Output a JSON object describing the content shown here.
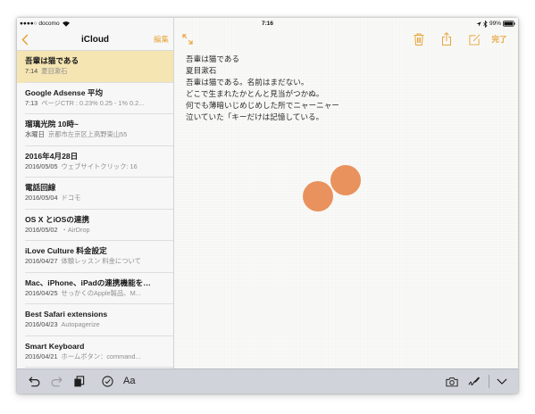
{
  "status_bar": {
    "carrier": "●●●●○ docomo",
    "time": "7:16",
    "battery_percent": "99%",
    "icons": [
      "wifi-icon",
      "location-icon",
      "bluetooth-icon",
      "battery-icon"
    ]
  },
  "sidebar": {
    "back_icon": "chevron-left-icon",
    "title": "iCloud",
    "edit_label": "編集",
    "notes": [
      {
        "title": "吾輩は猫である",
        "date": "7:14",
        "preview": "夏目漱石",
        "selected": true
      },
      {
        "title": "Google Adsense 平均",
        "date": "7:13",
        "preview": "ページCTR : 0.23% 0.25 - 1% 0.2..."
      },
      {
        "title": "瑠璃光院 10時~",
        "date": "水曜日",
        "preview": "京都市左京区上高野東山55"
      },
      {
        "title": "2016年4月28日",
        "date": "2016/05/05",
        "preview": "ウェブサイトクリック: 16"
      },
      {
        "title": "電話回線",
        "date": "2016/05/04",
        "preview": "ドコモ"
      },
      {
        "title": "OS X とiOSの連携",
        "date": "2016/05/02",
        "preview": "・AirDrop"
      },
      {
        "title": "iLove Culture 料金設定",
        "date": "2016/04/27",
        "preview": "体験レッスン 料金について"
      },
      {
        "title": "Mac、iPhone、iPadの連携機能を…",
        "date": "2016/04/25",
        "preview": "せっかくのApple製品、M..."
      },
      {
        "title": "Best Safari extensions",
        "date": "2016/04/23",
        "preview": "Autopagerize"
      },
      {
        "title": "Smart Keyboard",
        "date": "2016/04/21",
        "preview": "ホームボタン：command..."
      }
    ]
  },
  "editor": {
    "toolbar_icons": [
      "expand-icon",
      "trash-icon",
      "share-icon",
      "compose-icon"
    ],
    "done_label": "完了",
    "lines": [
      "吾輩は猫である",
      "夏目漱石",
      "吾輩は猫である。名前はまだない。",
      "どこで生まれたかとんと見当がつかぬ。",
      "何でも薄暗いじめじめした所でニャーニャー",
      "泣いていた「キーだけは記憶している。"
    ]
  },
  "shortcut_bar": {
    "format_label": "Aa",
    "icons": [
      "undo-icon",
      "redo-icon",
      "paste-icon",
      "checklist-icon",
      "camera-icon",
      "sketch-icon",
      "hide-keyboard-icon"
    ]
  },
  "colors": {
    "accent": "#e8a53c",
    "selected_row": "#f5e5b3",
    "touch_indicator": "#e9925d",
    "toolbar": "#d0d3d9"
  }
}
